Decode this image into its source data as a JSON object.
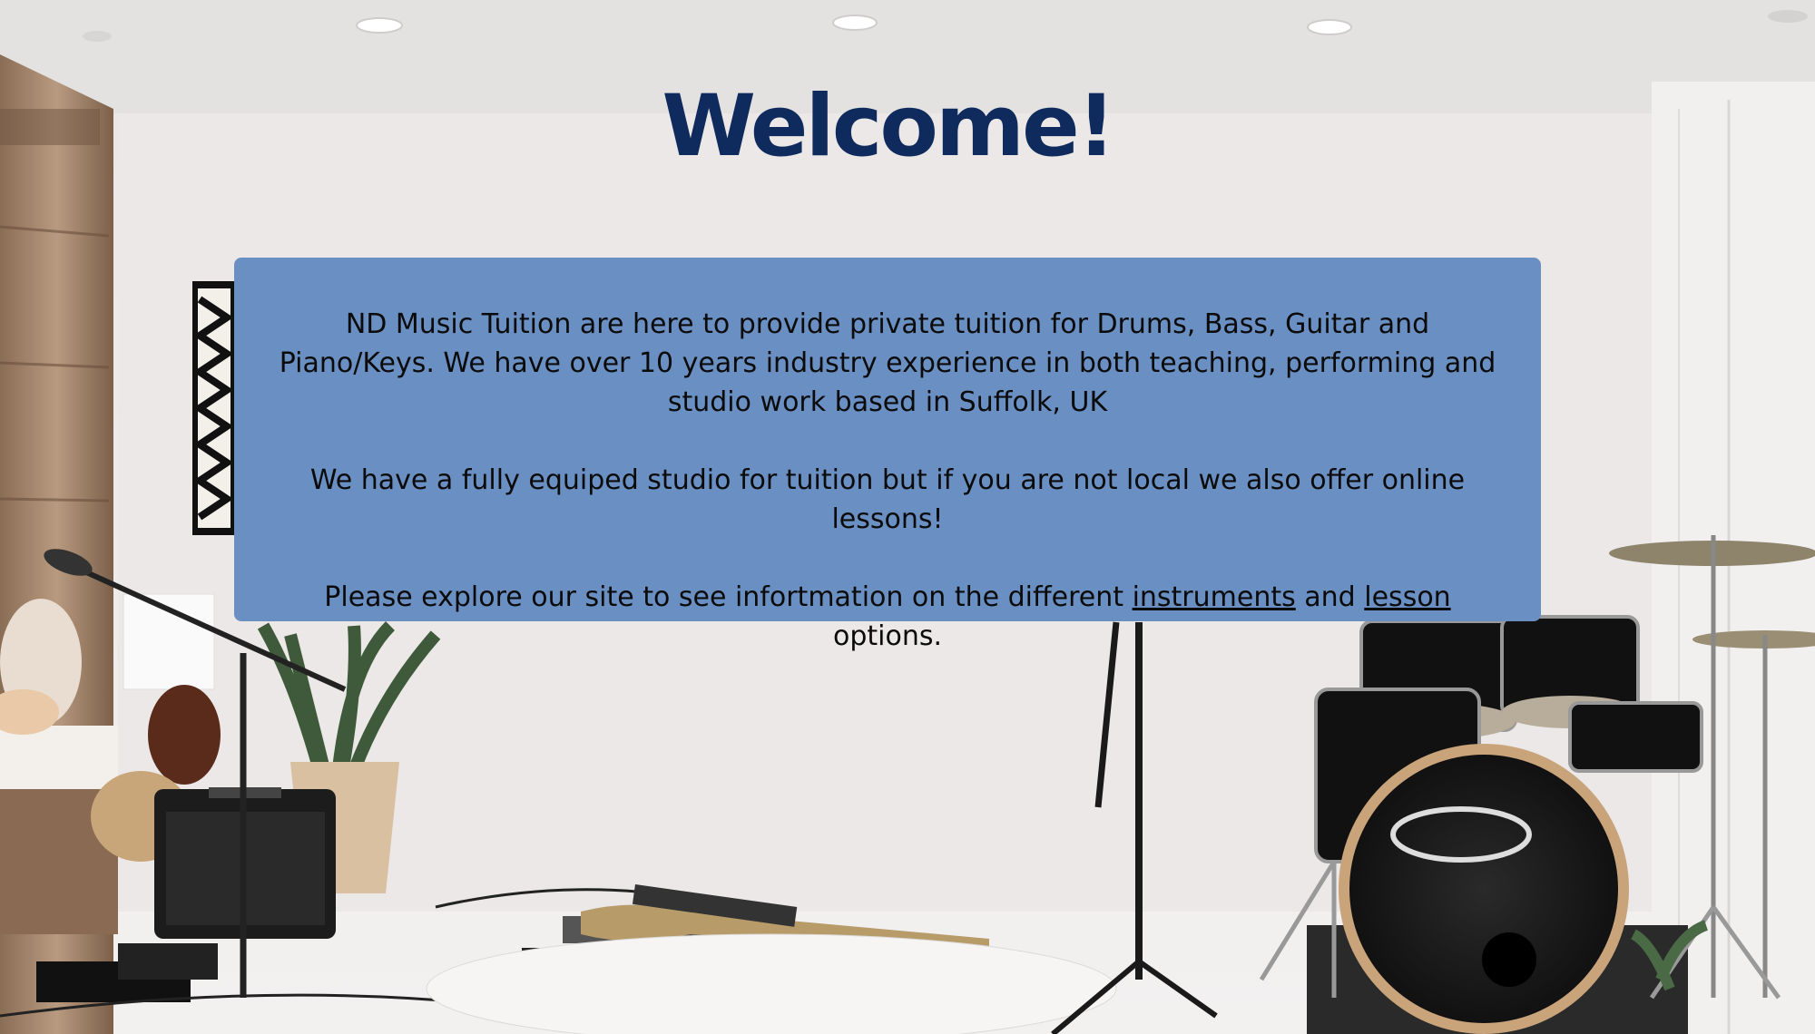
{
  "page": {
    "heading": "Welcome!"
  },
  "intro": {
    "paragraph1": "ND Music Tuition are here to provide private tuition for Drums, Bass, Guitar and Piano/Keys. We have over 10 years industry experience in both teaching, performing and studio work based in Suffolk, UK",
    "paragraph2": "We have a fully equiped studio for tuition but if you are not local we also offer online lessons!",
    "paragraph3_before": "Please explore our site to see infortmation on the different ",
    "instruments_link": "instruments",
    "paragraph3_middle": " and ",
    "lesson_link": "lesson",
    "paragraph3_after": " options."
  },
  "colors": {
    "heading": "#0f2a5c",
    "panel_background": "#6a8fc2",
    "body_text": "#0b0b0b"
  },
  "background_image": {
    "scene_icon": "music-studio-photo"
  }
}
